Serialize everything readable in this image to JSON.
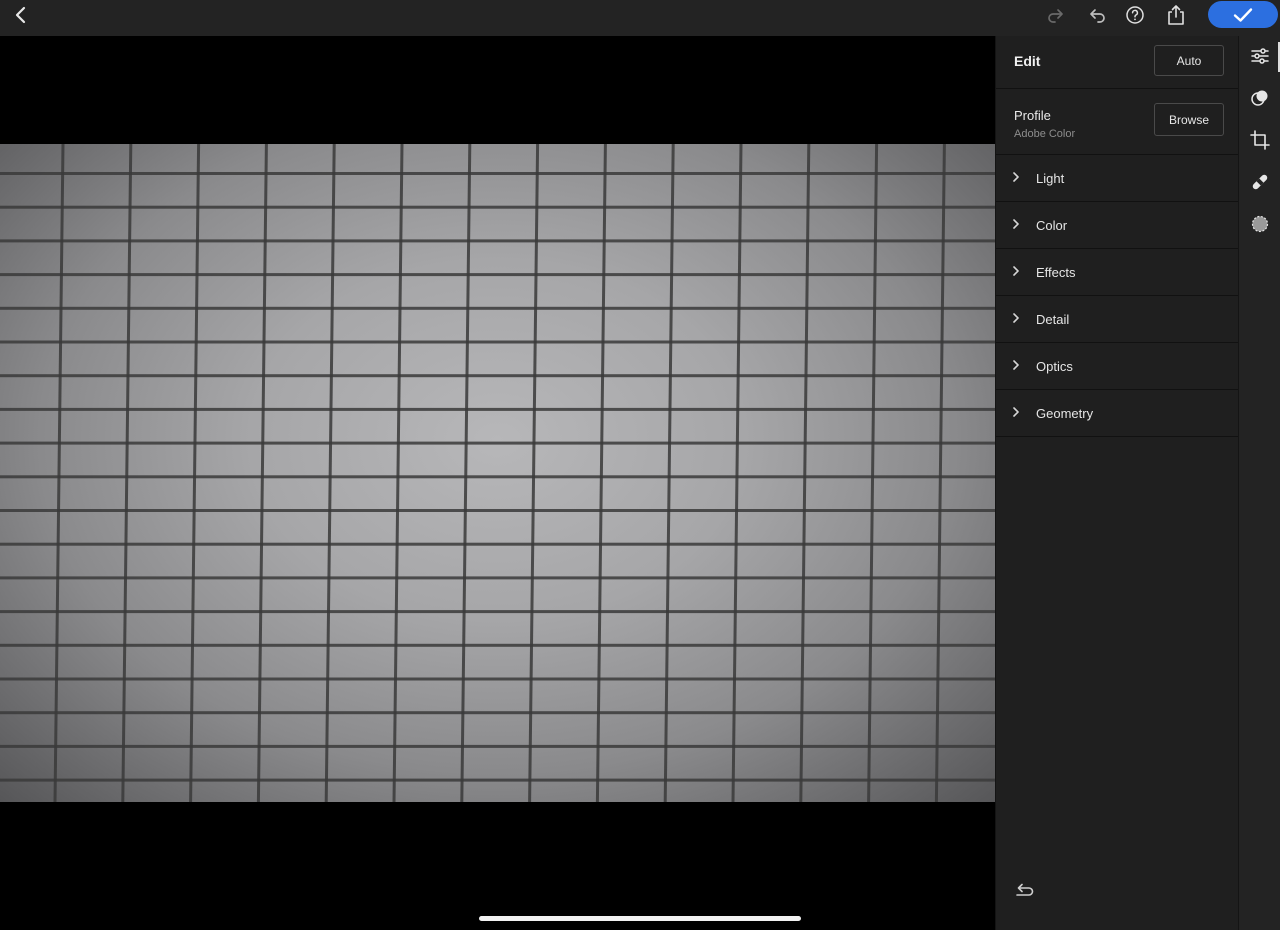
{
  "topbar": {
    "back_icon": "chevron-left-icon",
    "redo_icon": "redo-icon",
    "undo_icon": "undo-icon",
    "help_icon": "help-icon",
    "share_icon": "share-icon",
    "done_icon": "checkmark-icon",
    "done_color": "#2c6fe0"
  },
  "panel": {
    "title": "Edit",
    "auto_label": "Auto",
    "profile": {
      "label": "Profile",
      "value": "Adobe Color",
      "browse_label": "Browse"
    },
    "sections": [
      {
        "label": "Light"
      },
      {
        "label": "Color"
      },
      {
        "label": "Effects"
      },
      {
        "label": "Detail"
      },
      {
        "label": "Optics"
      },
      {
        "label": "Geometry"
      }
    ],
    "reset_icon": "reset-icon"
  },
  "rail": {
    "items": [
      {
        "icon": "edit-sliders-icon",
        "active": true
      },
      {
        "icon": "masking-icon",
        "active": false
      },
      {
        "icon": "crop-icon",
        "active": false
      },
      {
        "icon": "healing-icon",
        "active": false
      },
      {
        "icon": "selective-icon",
        "active": false
      }
    ]
  },
  "colors": {
    "accent": "#2c6fe0",
    "panel_bg": "#1f1f1f",
    "topbar_bg": "#232323"
  }
}
